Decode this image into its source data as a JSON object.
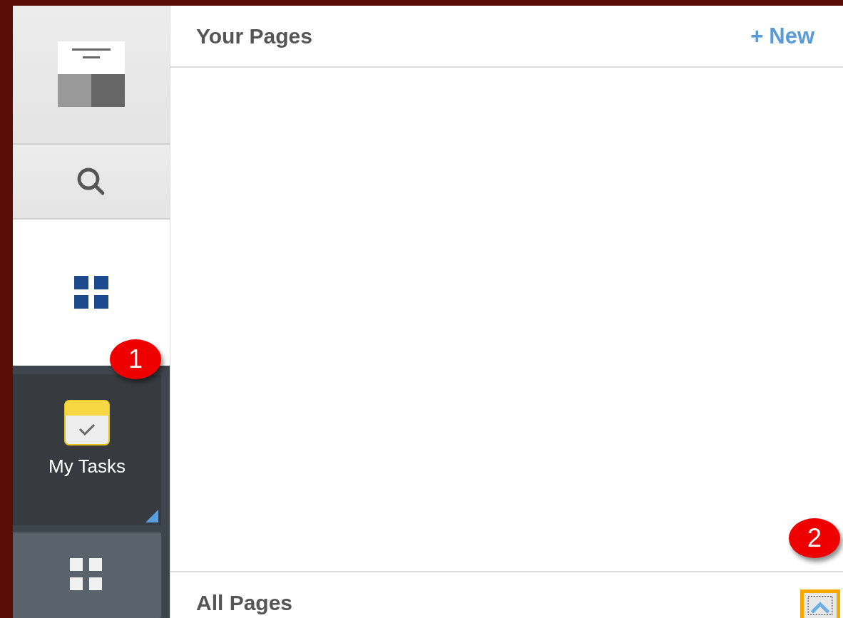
{
  "sidebar": {
    "nav": [
      {
        "kind": "logo",
        "selected": false
      },
      {
        "kind": "search",
        "selected": false
      },
      {
        "kind": "pages",
        "selected": true
      }
    ],
    "tiles": [
      {
        "kind": "tasks",
        "label": "My Tasks"
      },
      {
        "kind": "apps"
      }
    ]
  },
  "your_pages": {
    "title": "Your Pages",
    "new_button": {
      "icon": "+",
      "label": "New"
    }
  },
  "all_pages": {
    "title": "All Pages"
  },
  "callouts": [
    "1",
    "2"
  ]
}
